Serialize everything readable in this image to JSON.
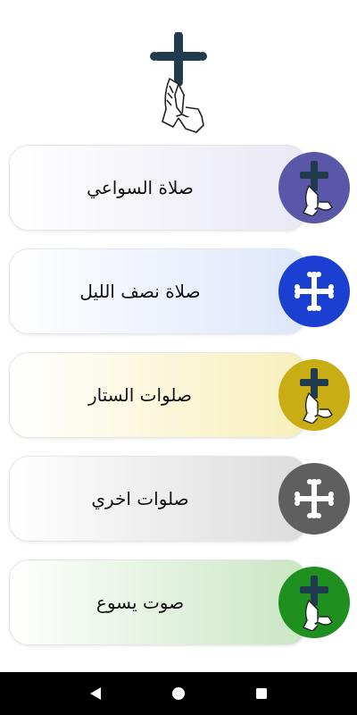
{
  "menu": {
    "items": [
      {
        "label": "صلاة السواعي",
        "icon": "cross-praying-hands-icon",
        "circle_color": "#5a57a8",
        "card_gradient_end": "#e9e8f4"
      },
      {
        "label": "صلاة نصف الليل",
        "icon": "coptic-cross-icon",
        "circle_color": "#1b3fd0",
        "card_gradient_end": "#dde6fb"
      },
      {
        "label": "صلوات الستار",
        "icon": "cross-praying-hands-icon",
        "circle_color": "#c9ad14",
        "card_gradient_end": "#f7efba"
      },
      {
        "label": "صلوات اخري",
        "icon": "coptic-cross-icon",
        "circle_color": "#5f5f5f",
        "card_gradient_end": "#dcdcdc"
      },
      {
        "label": "صوت يسوع",
        "icon": "cross-praying-hands-icon",
        "circle_color": "#1f8f1f",
        "card_gradient_end": "#c9e6c2"
      }
    ]
  },
  "header": {
    "icon": "cross-praying-hands-logo-icon"
  },
  "navbar": {
    "back": "back-icon",
    "home": "home-icon",
    "recents": "recents-icon"
  }
}
